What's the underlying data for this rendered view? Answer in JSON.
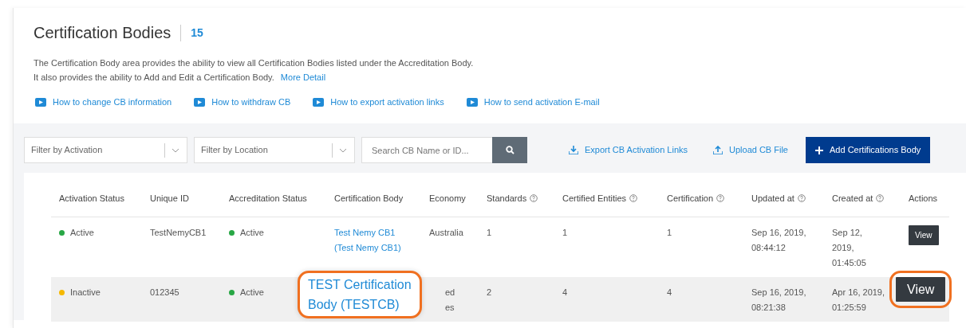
{
  "header": {
    "title": "Certification Bodies",
    "count": "15",
    "description": [
      "The Certification Body area provides the ability to view all Certification Bodies listed under the Accreditation Body.",
      "It also provides the ability to Add and Edit a Certification Body."
    ],
    "more_link": "More Detail",
    "help_links": [
      "How to change CB information",
      "How to withdraw CB",
      "How to export activation links",
      "How to send activation E-mail"
    ]
  },
  "toolbar": {
    "filters": [
      {
        "placeholder": "Filter by Activation"
      },
      {
        "placeholder": "Filter by Location"
      }
    ],
    "search": {
      "placeholder": "Search CB Name or ID..."
    },
    "actions": [
      {
        "kind": "export",
        "label": "Export CB Activation Links"
      },
      {
        "kind": "upload",
        "label": "Upload CB File"
      },
      {
        "kind": "add",
        "label": "Add Certifications Body"
      }
    ]
  },
  "table": {
    "columns": [
      {
        "label": "Activation Status",
        "help": false
      },
      {
        "label": "Unique ID",
        "help": false
      },
      {
        "label": "Accreditation Status",
        "help": false
      },
      {
        "label": "Certification Body",
        "help": false
      },
      {
        "label": "Economy",
        "help": false
      },
      {
        "label": "Standards",
        "help": true
      },
      {
        "label": "Certified Entities",
        "help": true
      },
      {
        "label": "Certification",
        "help": true
      },
      {
        "label": "Updated at",
        "help": true
      },
      {
        "label": "Created at",
        "help": true
      },
      {
        "label": "Actions",
        "help": false
      }
    ],
    "rows": [
      {
        "highlighted": false,
        "activation": {
          "label": "Active",
          "color": "#28a745"
        },
        "unique_id": "TestNemyCB1",
        "accreditation": {
          "label": "Active",
          "color": "#28a745"
        },
        "certification_body": [
          "Test Nemy CB1",
          "(Test Nemy CB1)"
        ],
        "economy": [
          "Australia"
        ],
        "standards": "1",
        "certified_entities": "1",
        "certification": "1",
        "updated_at": [
          "Sep 16, 2019,",
          "08:44:12"
        ],
        "created_at": [
          "Sep 12,",
          "2019,",
          "01:45:05"
        ],
        "action": "View",
        "callout": false
      },
      {
        "highlighted": true,
        "activation": {
          "label": "Inactive",
          "color": "#f5b800"
        },
        "unique_id": "012345",
        "accreditation": {
          "label": "Active",
          "color": "#28a745"
        },
        "certification_body": [
          "TEST Certification",
          "Body (TESTCB)"
        ],
        "economy": [
          "ed",
          "es"
        ],
        "standards": "2",
        "certified_entities": "4",
        "certification": "4",
        "updated_at": [
          "Sep 16, 2019,",
          "08:21:38"
        ],
        "created_at": [
          "Apr 16, 2019,",
          "01:25:59"
        ],
        "action": "View",
        "callout": true
      }
    ]
  }
}
